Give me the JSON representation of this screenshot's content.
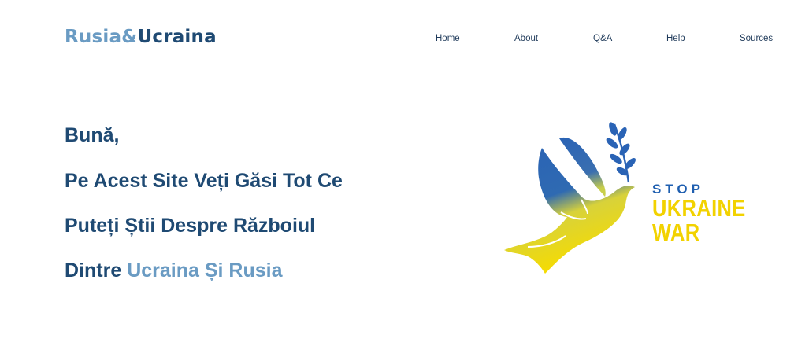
{
  "header": {
    "logo_part1": "Rusia&",
    "logo_part2": "Ucraina"
  },
  "nav": {
    "items": [
      {
        "label": "Home"
      },
      {
        "label": "About"
      },
      {
        "label": "Q&A"
      },
      {
        "label": "Help"
      },
      {
        "label": "Sources"
      }
    ]
  },
  "hero": {
    "line1": "Bună,",
    "line2": "Pe Acest Site Veți Găsi Tot Ce",
    "line3": "Puteți Știi Despre Războiul",
    "line4_prefix": "Dintre ",
    "line4_accent": "Ucraina Și Rusia"
  },
  "emblem": {
    "icon": "peace-dove-icon",
    "line1": "STOP",
    "line2": "UKRAINE",
    "line3": "WAR",
    "colors": {
      "blue": "#1f5fb0",
      "yellow": "#f2d200"
    }
  }
}
